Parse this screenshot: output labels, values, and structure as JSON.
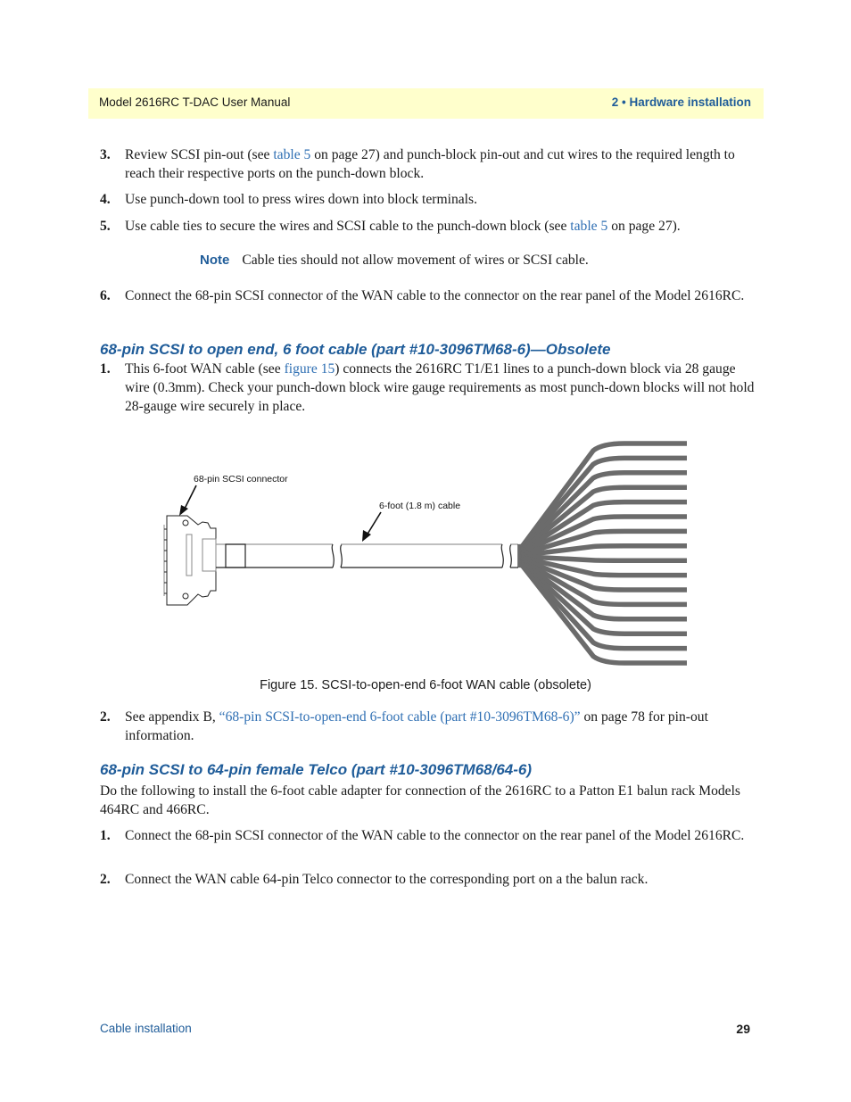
{
  "header": {
    "manual_title": "Model 2616RC T-DAC User Manual",
    "chapter": "2 • Hardware installation"
  },
  "steps_a": [
    {
      "num": "3.",
      "pre": "Review SCSI pin-out (see ",
      "link": "table 5",
      "post": " on page 27) and punch-block pin-out and cut wires to the required length to reach their respective ports on the punch-down block."
    },
    {
      "num": "4.",
      "pre": "Use punch-down tool to press wires down into block terminals.",
      "link": "",
      "post": ""
    },
    {
      "num": "5.",
      "pre": "Use cable ties to secure the wires and SCSI cable to the punch-down block (see ",
      "link": "table 5",
      "post": " on page 27)."
    }
  ],
  "note": {
    "label": "Note",
    "text": "Cable ties should not allow movement of wires or SCSI cable."
  },
  "step6": {
    "num": "6.",
    "text": "Connect the 68-pin SCSI connector of the WAN cable  to the connector on the rear panel of the Model 2616RC."
  },
  "section1": {
    "heading": "68-pin SCSI to open end, 6 foot cable (part #10-3096TM68-6)—Obsolete",
    "step1": {
      "num": "1.",
      "pre": "This 6-foot WAN cable (see ",
      "link": "figure 15",
      "post": ") connects the 2616RC T1/E1 lines to a punch-down block via 28 gauge wire (0.3mm). Check your punch-down block wire gauge requirements as most punch-down blocks will not hold 28-gauge wire securely in place."
    },
    "figure": {
      "label_connector": "68-pin SCSI connector",
      "label_cable": "6-foot (1.8 m) cable",
      "caption": "Figure 15. SCSI-to-open-end 6-foot WAN cable (obsolete)",
      "wire_count": 16
    },
    "step2": {
      "num": "2.",
      "pre": "See appendix B, ",
      "link": "“68-pin SCSI-to-open-end 6-foot cable (part #10-3096TM68-6)”",
      "post": " on page 78 for pin-out information."
    }
  },
  "section2": {
    "heading": "68-pin SCSI to 64-pin female Telco (part #10-3096TM68/64-6)",
    "intro": "Do the following to install the 6-foot cable adapter for connection of the 2616RC to a Patton E1 balun rack Models 464RC and 466RC.",
    "steps": [
      {
        "num": "1.",
        "text": "Connect the 68-pin SCSI connector of the WAN cable  to the connector on the rear panel of the Model 2616RC."
      },
      {
        "num": "2.",
        "text": "Connect the WAN cable 64-pin Telco connector to the corresponding port on a the balun rack."
      }
    ]
  },
  "footer": {
    "section": "Cable installation",
    "page_number": "29"
  },
  "colors": {
    "header_bg": "#ffffcc",
    "accent_blue": "#1f5c99",
    "link_blue": "#2f6fb3",
    "wire_gray": "#6b6b6b"
  }
}
